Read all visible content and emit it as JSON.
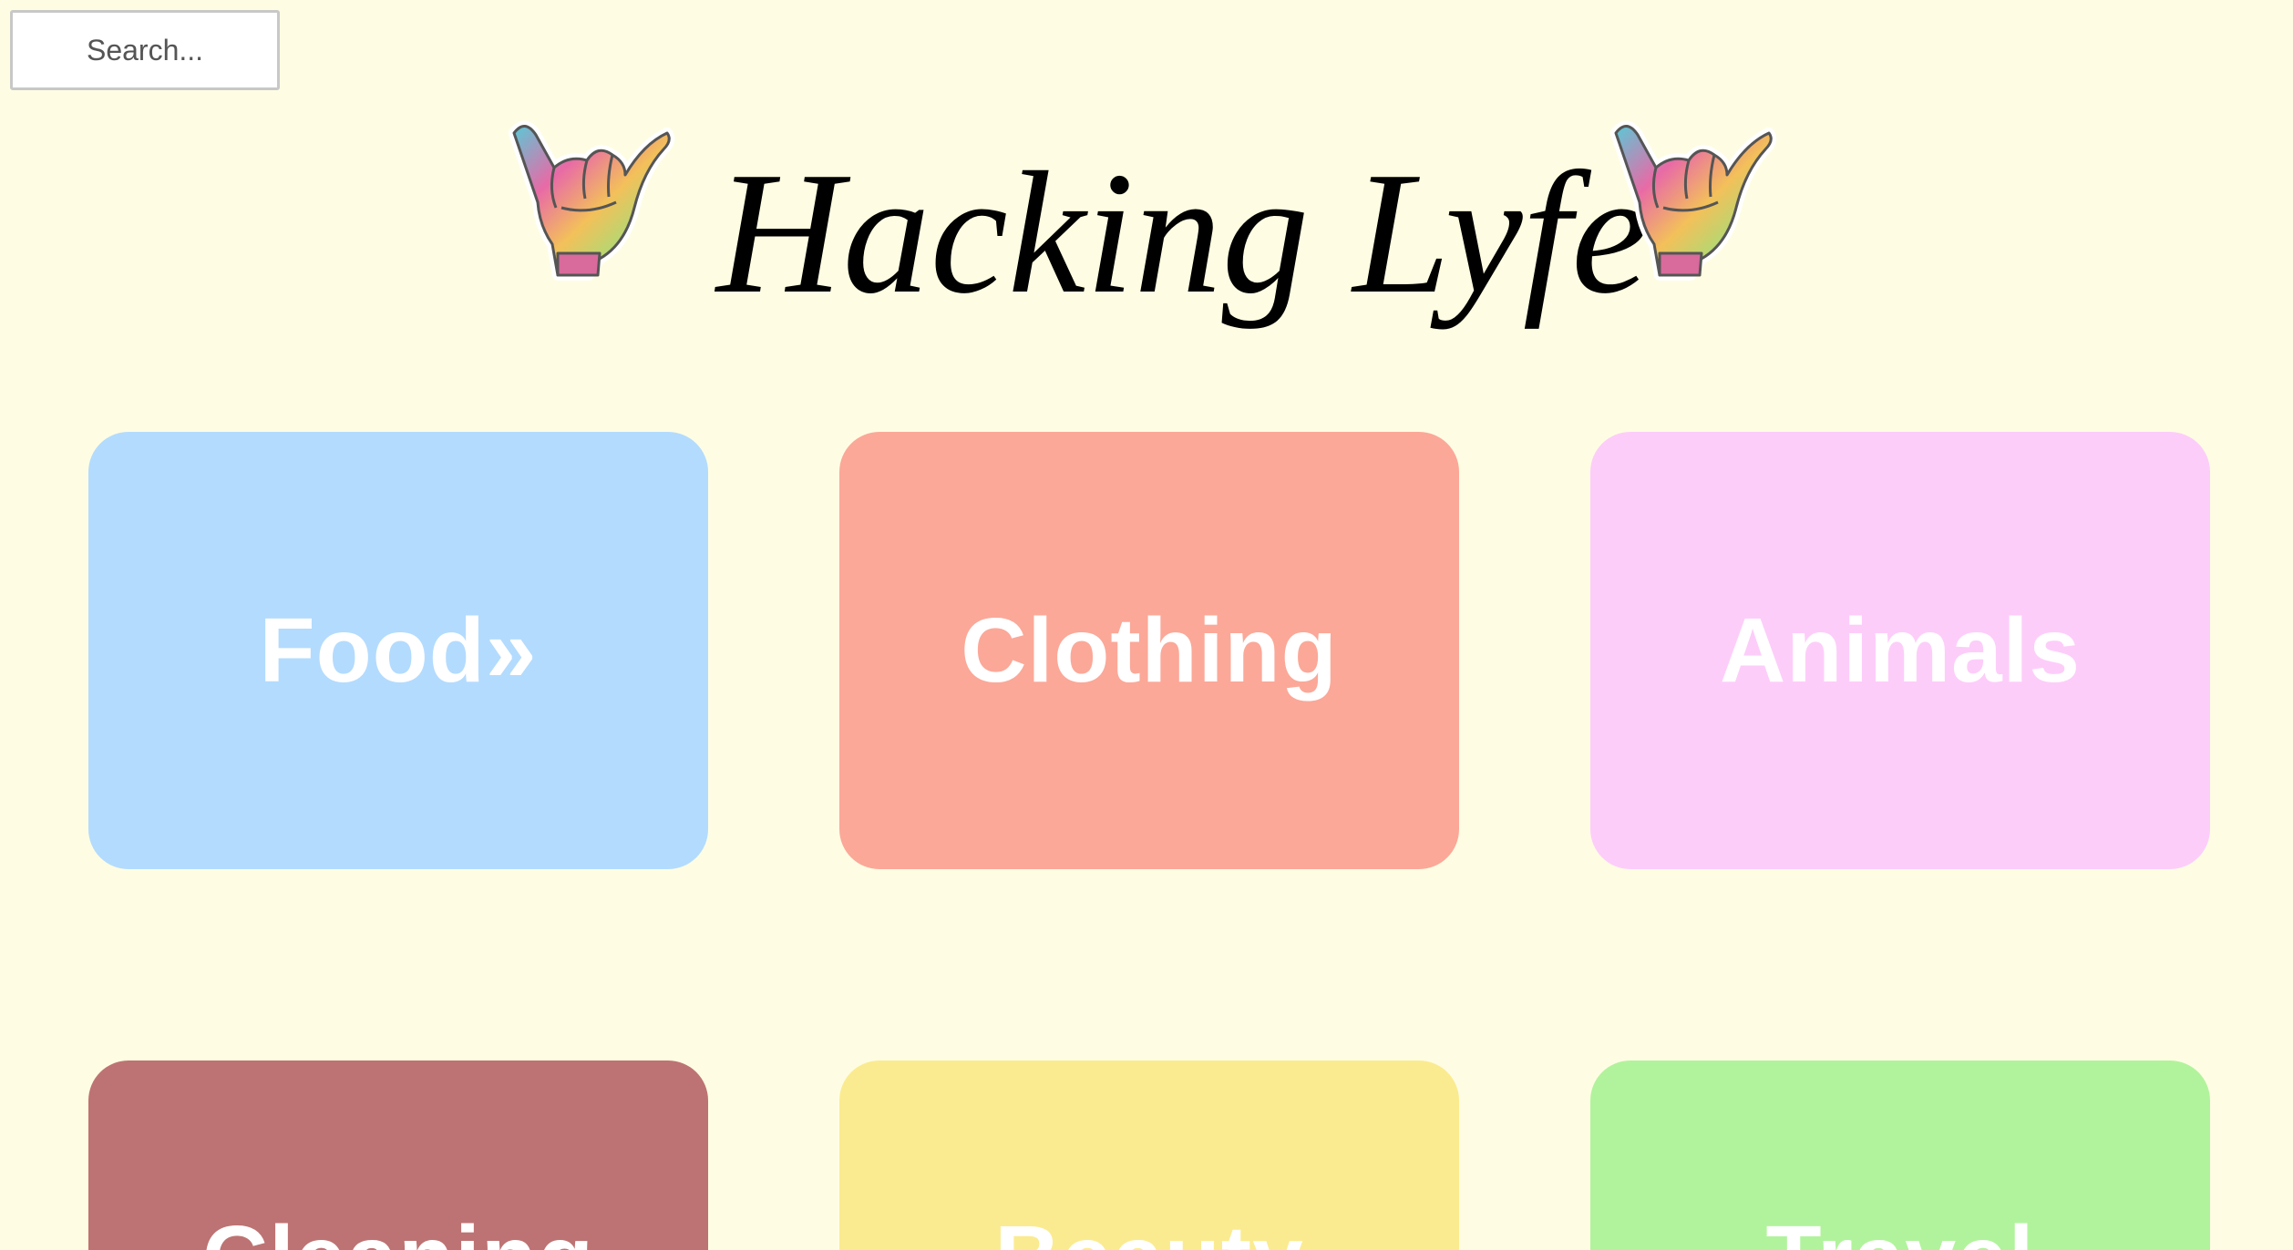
{
  "search": {
    "placeholder": "Search..."
  },
  "header": {
    "title": "Hacking Lyfe",
    "left_icon": "shaka-hand-icon",
    "right_icon": "shaka-hand-icon"
  },
  "categories": [
    {
      "label": "Food»",
      "color": "#b3dbfe"
    },
    {
      "label": "Clothing",
      "color": "#fba898"
    },
    {
      "label": "Animals",
      "color": "#fdcdfa"
    },
    {
      "label": "Cleaning",
      "color": "#bd7373"
    },
    {
      "label": "Beauty",
      "color": "#fbeb90"
    },
    {
      "label": "Travel",
      "color": "#b1f39c"
    }
  ],
  "colors": {
    "background": "#fefde3",
    "title": "#000000",
    "card_text": "#ffffff"
  }
}
